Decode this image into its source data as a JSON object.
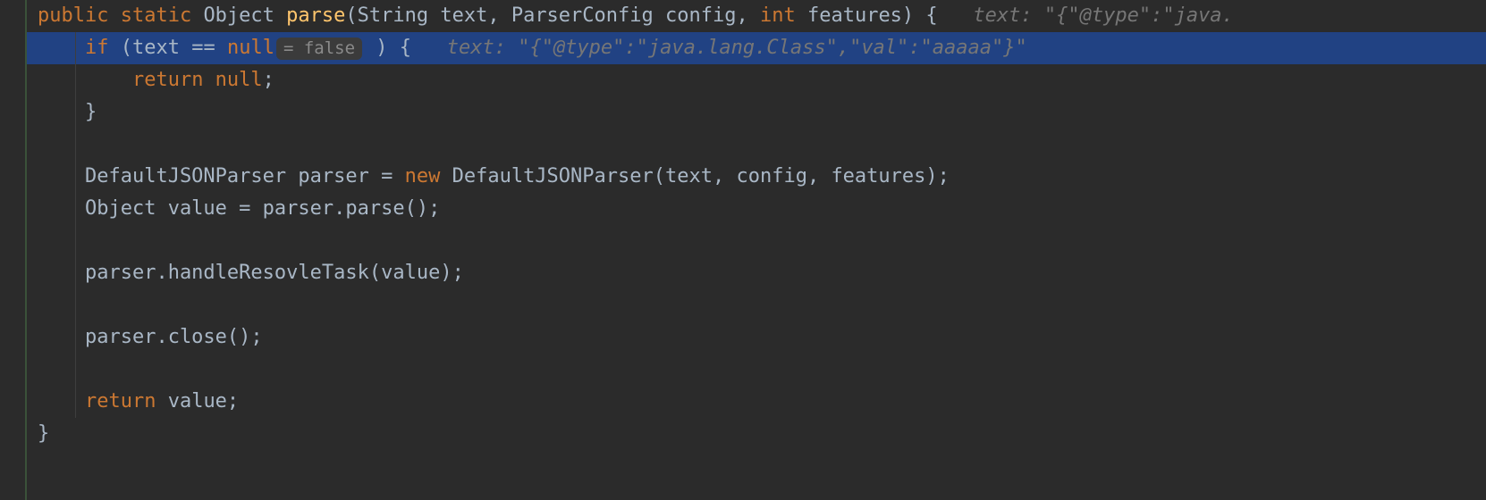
{
  "code": {
    "lines": [
      {
        "highlight": false,
        "segments": [
          {
            "t": "kw",
            "v": "public "
          },
          {
            "t": "kw",
            "v": "static "
          },
          {
            "t": "id",
            "v": "Object "
          },
          {
            "t": "fn",
            "v": "parse"
          },
          {
            "t": "id",
            "v": "(String text, ParserConfig config, "
          },
          {
            "t": "kw",
            "v": "int "
          },
          {
            "t": "id",
            "v": "features) {   "
          },
          {
            "t": "hint",
            "v": "text: \"{\"@type\":\"java."
          }
        ]
      },
      {
        "highlight": true,
        "segments": [
          {
            "t": "id",
            "v": "    "
          },
          {
            "t": "kw",
            "v": "if "
          },
          {
            "t": "id",
            "v": "(text == "
          },
          {
            "t": "kw",
            "v": "null"
          },
          {
            "t": "inlay",
            "v": "= false"
          },
          {
            "t": "id",
            "v": " ) {   "
          },
          {
            "t": "hint",
            "v": "text: \"{\"@type\":\"java.lang.Class\",\"val\":\"aaaaa\"}\""
          }
        ]
      },
      {
        "highlight": false,
        "segments": [
          {
            "t": "id",
            "v": "        "
          },
          {
            "t": "kw",
            "v": "return null"
          },
          {
            "t": "id",
            "v": ";"
          }
        ]
      },
      {
        "highlight": false,
        "segments": [
          {
            "t": "id",
            "v": "    }"
          }
        ]
      },
      {
        "highlight": false,
        "segments": [
          {
            "t": "id",
            "v": ""
          }
        ]
      },
      {
        "highlight": false,
        "segments": [
          {
            "t": "id",
            "v": "    DefaultJSONParser parser = "
          },
          {
            "t": "kw",
            "v": "new "
          },
          {
            "t": "id",
            "v": "DefaultJSONParser(text, config, features);"
          }
        ]
      },
      {
        "highlight": false,
        "segments": [
          {
            "t": "id",
            "v": "    Object value = parser.parse();"
          }
        ]
      },
      {
        "highlight": false,
        "segments": [
          {
            "t": "id",
            "v": ""
          }
        ]
      },
      {
        "highlight": false,
        "segments": [
          {
            "t": "id",
            "v": "    parser.handleResovleTask(value);"
          }
        ]
      },
      {
        "highlight": false,
        "segments": [
          {
            "t": "id",
            "v": ""
          }
        ]
      },
      {
        "highlight": false,
        "segments": [
          {
            "t": "id",
            "v": "    parser.close();"
          }
        ]
      },
      {
        "highlight": false,
        "segments": [
          {
            "t": "id",
            "v": ""
          }
        ]
      },
      {
        "highlight": false,
        "segments": [
          {
            "t": "id",
            "v": "    "
          },
          {
            "t": "kw",
            "v": "return "
          },
          {
            "t": "id",
            "v": "value;"
          }
        ]
      },
      {
        "highlight": false,
        "segments": [
          {
            "t": "id",
            "v": "}"
          }
        ]
      }
    ]
  }
}
